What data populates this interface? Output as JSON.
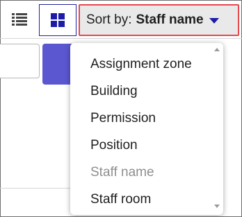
{
  "toolbar": {
    "list_view_icon": "list-icon",
    "grid_view_icon": "grid-icon",
    "sort": {
      "prefix": "Sort by:",
      "value": "Staff name",
      "caret_icon": "caret-down-icon",
      "accent_color": "#1c1ca8",
      "border_color": "#e5484d"
    }
  },
  "sort_menu": {
    "items": [
      {
        "label": "Assignment zone",
        "disabled": false
      },
      {
        "label": "Building",
        "disabled": false
      },
      {
        "label": "Permission",
        "disabled": false
      },
      {
        "label": "Position",
        "disabled": false
      },
      {
        "label": "Staff name",
        "disabled": true
      },
      {
        "label": "Staff room",
        "disabled": false
      }
    ]
  },
  "colors": {
    "primary_button": "#5b57d1"
  }
}
